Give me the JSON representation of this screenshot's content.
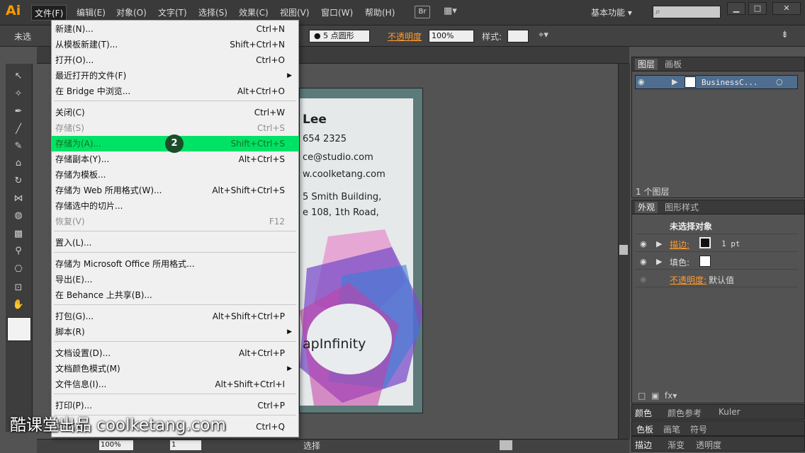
{
  "app": {
    "logo": "Ai",
    "bridge": "Br",
    "workspace": "基本功能"
  },
  "menubar": [
    {
      "label": "文件(F)",
      "active": true
    },
    {
      "label": "编辑(E)"
    },
    {
      "label": "对象(O)"
    },
    {
      "label": "文字(T)"
    },
    {
      "label": "选择(S)"
    },
    {
      "label": "效果(C)"
    },
    {
      "label": "视图(V)"
    },
    {
      "label": "窗口(W)"
    },
    {
      "label": "帮助(H)"
    }
  ],
  "control_bar": {
    "selection": "未选",
    "brush": "5 点圆形",
    "opacity_label": "不透明度",
    "opacity_value": "100%",
    "style_label": "样式:"
  },
  "file_menu": {
    "items": [
      {
        "label": "新建(N)...",
        "shortcut": "Ctrl+N"
      },
      {
        "label": "从模板新建(T)...",
        "shortcut": "Shift+Ctrl+N"
      },
      {
        "label": "打开(O)...",
        "shortcut": "Ctrl+O"
      },
      {
        "label": "最近打开的文件(F)",
        "submenu": true
      },
      {
        "label": "在 Bridge 中浏览...",
        "shortcut": "Alt+Ctrl+O"
      },
      {
        "label": "关闭(C)",
        "shortcut": "Ctrl+W"
      },
      {
        "label": "存储(S)",
        "shortcut": "Ctrl+S",
        "disabled": true
      },
      {
        "label": "存储为(A)...",
        "shortcut": "Shift+Ctrl+S",
        "highlighted": true
      },
      {
        "label": "存储副本(Y)...",
        "shortcut": "Alt+Ctrl+S"
      },
      {
        "label": "存储为模板..."
      },
      {
        "label": "存储为 Web 所用格式(W)...",
        "shortcut": "Alt+Shift+Ctrl+S"
      },
      {
        "label": "存储选中的切片..."
      },
      {
        "label": "恢复(V)",
        "shortcut": "F12",
        "disabled": true
      },
      {
        "label": "置入(L)..."
      },
      {
        "label": "存储为 Microsoft Office 所用格式..."
      },
      {
        "label": "导出(E)..."
      },
      {
        "label": "在 Behance 上共享(B)..."
      },
      {
        "label": "打包(G)...",
        "shortcut": "Alt+Shift+Ctrl+P"
      },
      {
        "label": "脚本(R)",
        "submenu": true
      },
      {
        "label": "文档设置(D)...",
        "shortcut": "Alt+Ctrl+P"
      },
      {
        "label": "文档颜色模式(M)",
        "submenu": true
      },
      {
        "label": "文件信息(I)...",
        "shortcut": "Alt+Shift+Ctrl+I"
      },
      {
        "label": "打印(P)...",
        "shortcut": "Ctrl+P"
      },
      {
        "label": "退出(X)",
        "shortcut": "Ctrl+Q"
      }
    ],
    "step_badge": "2"
  },
  "artboard_text": {
    "name": "Lee",
    "phone": "654 2325",
    "email": "ce@studio.com",
    "web": "w.coolketang.com",
    "addr1": "5 Smith Building,",
    "addr2": "e 108, 1th Road,",
    "brand": "apInfinity"
  },
  "layers_panel": {
    "tabs": [
      "图层",
      "画板"
    ],
    "layer_name": "BusinessC...",
    "count": "1 个图层"
  },
  "appearance_panel": {
    "tabs": [
      "外观",
      "图形样式"
    ],
    "title": "未选择对象",
    "stroke_label": "描边:",
    "stroke_weight": "1 pt",
    "fill_label": "填色:",
    "opacity_label": "不透明度:",
    "opacity_value": "默认值"
  },
  "bottom_strips": [
    [
      "颜色",
      "颜色参考",
      "Kuler"
    ],
    [
      "色板",
      "画笔",
      "符号"
    ],
    [
      "描边",
      "渐变",
      "透明度"
    ]
  ],
  "statusbar": {
    "zoom": "100%",
    "page": "1",
    "status": "选择"
  },
  "watermark": "酷课堂出品 coolketang.com"
}
